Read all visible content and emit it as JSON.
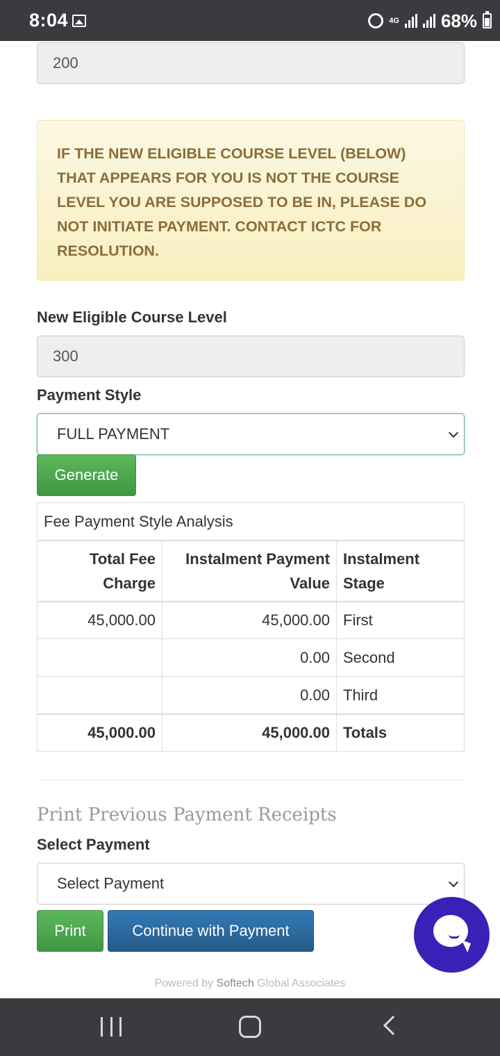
{
  "status_bar": {
    "time": "8:04",
    "network": "4G",
    "battery_percent": "68%"
  },
  "current_level": {
    "value": "200"
  },
  "alert": {
    "message": "IF THE NEW ELIGIBLE COURSE LEVEL (BELOW) THAT APPEARS FOR YOU IS NOT THE COURSE LEVEL YOU ARE SUPPOSED TO BE IN, PLEASE DO NOT INITIATE PAYMENT. CONTACT ICTC FOR RESOLUTION.",
    "color": "#8a6d3b"
  },
  "new_level": {
    "label": "New Eligible Course Level",
    "value": "300"
  },
  "payment_style": {
    "label": "Payment Style",
    "selected": "FULL PAYMENT"
  },
  "generate_button": "Generate",
  "fee_table": {
    "caption": "Fee Payment Style Analysis",
    "headers": {
      "total_fee": "Total Fee Charge",
      "instalment_value": "Instalment Payment Value",
      "instalment_stage": "Instalment Stage"
    },
    "rows": [
      {
        "total_fee": "45,000.00",
        "instalment_value": "45,000.00",
        "stage": "First"
      },
      {
        "total_fee": "",
        "instalment_value": "0.00",
        "stage": "Second"
      },
      {
        "total_fee": "",
        "instalment_value": "0.00",
        "stage": "Third"
      }
    ],
    "totals": {
      "total_fee": "45,000.00",
      "instalment_value": "45,000.00",
      "stage": "Totals"
    }
  },
  "receipts": {
    "title": "Print Previous Payment Receipts",
    "select_label": "Select Payment",
    "select_value": "Select Payment",
    "print_button": "Print",
    "continue_button": "Continue with Payment"
  },
  "footer": {
    "prefix": "Powered by ",
    "brand1": "Softech",
    "brand2": " Global Associates"
  },
  "colors": {
    "green": "#5cb85c",
    "blue": "#337ab7",
    "chat": "#3b20b8"
  }
}
